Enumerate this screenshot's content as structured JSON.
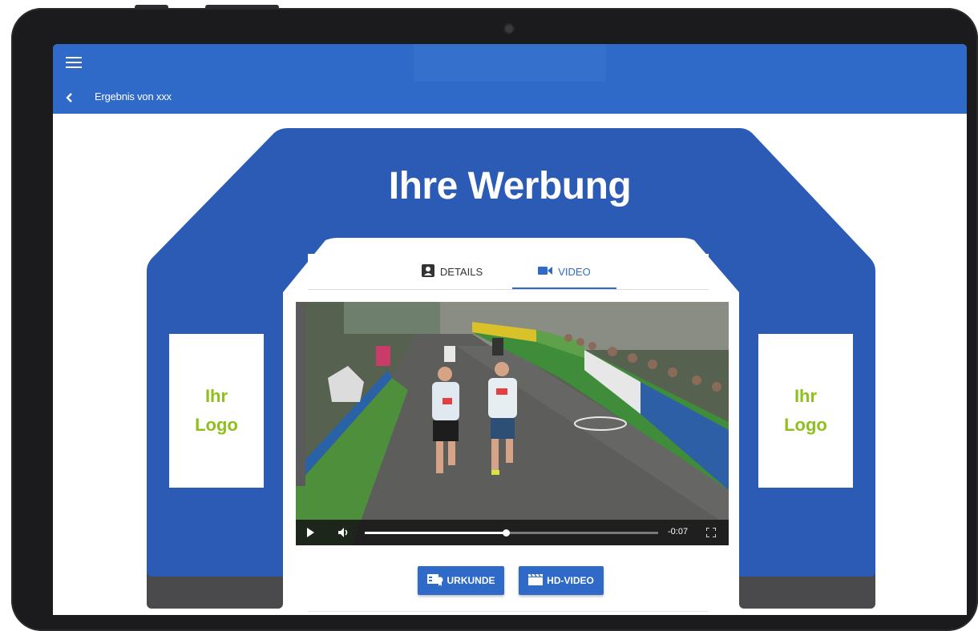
{
  "header": {
    "subtitle": "Ergebnis von xxx"
  },
  "ad": {
    "title": "Ihre Werbung",
    "logo_line1": "Ihr",
    "logo_line2": "Logo"
  },
  "tabs": [
    {
      "label": "DETAILS",
      "icon": "person-card-icon",
      "active": false
    },
    {
      "label": "VIDEO",
      "icon": "videocam-icon",
      "active": true
    }
  ],
  "video": {
    "time_remaining": "-0:07",
    "progress": 0.48
  },
  "actions": {
    "urkunde_label": "URKUNDE",
    "hdvideo_label": "HD-VIDEO"
  },
  "colors": {
    "brand_blue": "#2f6ac8",
    "arch_blue": "#2b5bb5",
    "logo_green": "#8fbf1e",
    "arch_base": "#4a4a4c"
  }
}
